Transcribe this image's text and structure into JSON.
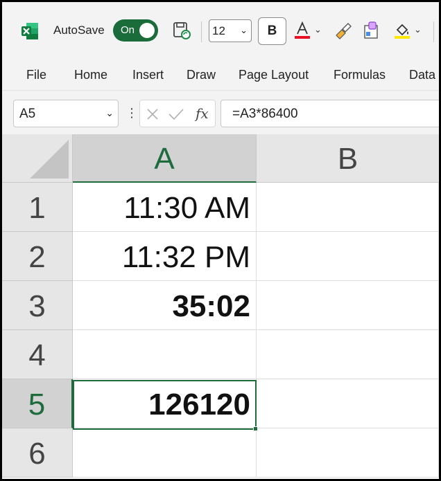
{
  "app": {
    "autosave_label": "AutoSave",
    "autosave_state": "On",
    "font_size": "12",
    "bold_label": "B",
    "accent_color": "#1e6b3c"
  },
  "ribbon": {
    "tabs": [
      "File",
      "Home",
      "Insert",
      "Draw",
      "Page Layout",
      "Formulas",
      "Data"
    ]
  },
  "formula_bar": {
    "name_box": "A5",
    "fx_label": "fx",
    "formula": "=A3*86400"
  },
  "sheet": {
    "columns": [
      "A",
      "B"
    ],
    "selected_column": "A",
    "rows": [
      {
        "num": "1",
        "a": "11:30 AM",
        "b": ""
      },
      {
        "num": "2",
        "a": "11:32 PM",
        "b": ""
      },
      {
        "num": "3",
        "a": "35:02",
        "b": ""
      },
      {
        "num": "4",
        "a": "",
        "b": ""
      },
      {
        "num": "5",
        "a": "126120",
        "b": ""
      },
      {
        "num": "6",
        "a": "",
        "b": ""
      }
    ],
    "selected_cell": "A5"
  }
}
